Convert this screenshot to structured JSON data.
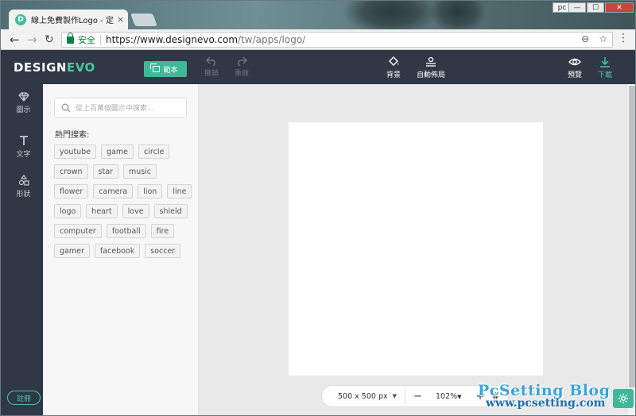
{
  "browser": {
    "tab_title": "線上免費製作Logo - 定制",
    "tab_favicon_letter": "D",
    "tab_close": "×",
    "profile": "pc",
    "window_min": "—",
    "window_max": "☐",
    "window_close": "✕",
    "secure_label": "安全",
    "url_host": "https://www.designevo.com",
    "url_path": "/tw/apps/logo/"
  },
  "header": {
    "logo_a": "DESIGN",
    "logo_b": "EVO",
    "template_label": "範本",
    "undo_label": "撤銷",
    "redo_label": "重做",
    "background_label": "背景",
    "auto_layout_label": "自動佈局",
    "preview_label": "預覽",
    "download_label": "下載"
  },
  "sidebar": {
    "items": [
      {
        "label": "圖示",
        "icon": "diamond-icon"
      },
      {
        "label": "文字",
        "icon": "text-t-icon"
      },
      {
        "label": "形狀",
        "icon": "shapes-icon"
      }
    ],
    "signup_label": "註冊"
  },
  "panel": {
    "search_placeholder": "從上百萬個圖示中搜索...",
    "hot_label": "熱門搜索:",
    "tag_rows": [
      [
        "youtube",
        "game",
        "circle"
      ],
      [
        "crown",
        "star",
        "music"
      ],
      [
        "flower",
        "camera",
        "lion",
        "line"
      ],
      [
        "logo",
        "heart",
        "love",
        "shield"
      ],
      [
        "computer",
        "football",
        "fire"
      ],
      [
        "gamer",
        "facebook",
        "soccer"
      ]
    ]
  },
  "canvas": {
    "size_label": "500 x 500 px",
    "zoom_label": "102%",
    "zoom_out": "−",
    "zoom_in": "+",
    "grid_symbol": "#"
  },
  "watermark": {
    "line1": "PcSetting Blog",
    "line2": "www.pcsetting.com"
  },
  "colors": {
    "header_bg": "#2f3844",
    "accent": "#3fb89a",
    "logo_accent": "#4cc6a7"
  }
}
